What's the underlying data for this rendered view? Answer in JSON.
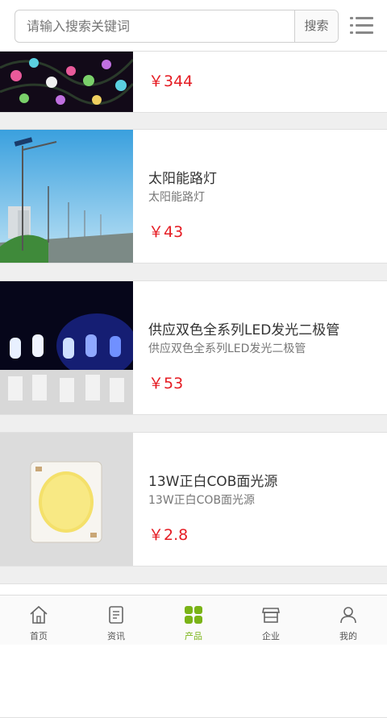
{
  "search": {
    "placeholder": "请输入搜索关键词",
    "button_label": "搜索"
  },
  "products": [
    {
      "name": "",
      "desc": "",
      "price": "￥344"
    },
    {
      "name": "太阳能路灯",
      "desc": "太阳能路灯",
      "price": "￥43"
    },
    {
      "name": "供应双色全系列LED发光二极管",
      "desc": "供应双色全系列LED发光二极管",
      "price": "￥53"
    },
    {
      "name": "13W正白COB面光源",
      "desc": "13W正白COB面光源",
      "price": "￥2.8"
    }
  ],
  "tabs": [
    {
      "label": "首页",
      "icon": "home-icon"
    },
    {
      "label": "资讯",
      "icon": "news-icon"
    },
    {
      "label": "产品",
      "icon": "grid-icon"
    },
    {
      "label": "企业",
      "icon": "store-icon"
    },
    {
      "label": "我的",
      "icon": "user-icon"
    }
  ],
  "colors": {
    "price": "#e51c23",
    "active_tab": "#7ab317"
  }
}
